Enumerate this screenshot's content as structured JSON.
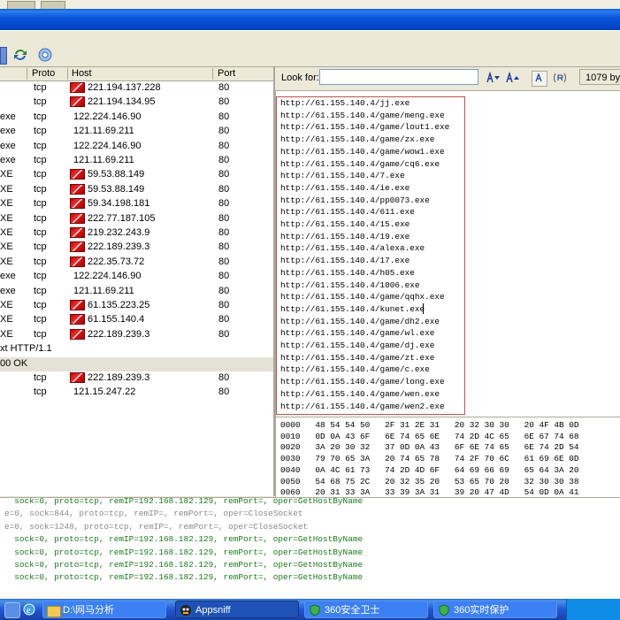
{
  "list": {
    "columns": [
      "Proto",
      "Host",
      "Port"
    ],
    "rows": [
      {
        "proc": "",
        "proto": "tcp",
        "host": "221.194.137.228",
        "port": "80",
        "flag": true
      },
      {
        "proc": "",
        "proto": "tcp",
        "host": "221.194.134.95",
        "port": "80",
        "flag": true
      },
      {
        "proc": "exe",
        "proto": "tcp",
        "host": "122.224.146.90",
        "port": "80",
        "flag": false
      },
      {
        "proc": "exe",
        "proto": "tcp",
        "host": "121.11.69.211",
        "port": "80",
        "flag": false
      },
      {
        "proc": "exe",
        "proto": "tcp",
        "host": "122.224.146.90",
        "port": "80",
        "flag": false
      },
      {
        "proc": "exe",
        "proto": "tcp",
        "host": "121.11.69.211",
        "port": "80",
        "flag": false
      },
      {
        "proc": "XE",
        "proto": "tcp",
        "host": "59.53.88.149",
        "port": "80",
        "flag": true
      },
      {
        "proc": "XE",
        "proto": "tcp",
        "host": "59.53.88.149",
        "port": "80",
        "flag": true
      },
      {
        "proc": "XE",
        "proto": "tcp",
        "host": "59.34.198.181",
        "port": "80",
        "flag": true
      },
      {
        "proc": "XE",
        "proto": "tcp",
        "host": "222.77.187.105",
        "port": "80",
        "flag": true
      },
      {
        "proc": "XE",
        "proto": "tcp",
        "host": "219.232.243.9",
        "port": "80",
        "flag": true
      },
      {
        "proc": "XE",
        "proto": "tcp",
        "host": "222.189.239.3",
        "port": "80",
        "flag": true
      },
      {
        "proc": "XE",
        "proto": "tcp",
        "host": "222.35.73.72",
        "port": "80",
        "flag": true
      },
      {
        "proc": "exe",
        "proto": "tcp",
        "host": "122.224.146.90",
        "port": "80",
        "flag": false
      },
      {
        "proc": "exe",
        "proto": "tcp",
        "host": "121.11.69.211",
        "port": "80",
        "flag": false
      },
      {
        "proc": "XE",
        "proto": "tcp",
        "host": "61.135.223.25",
        "port": "80",
        "flag": true
      },
      {
        "proc": "XE",
        "proto": "tcp",
        "host": "61.155.140.4",
        "port": "80",
        "flag": true
      },
      {
        "proc": "XE",
        "proto": "tcp",
        "host": "222.189.239.3",
        "port": "80",
        "flag": true
      }
    ],
    "band1": "xt HTTP/1.1",
    "band2": "00 OK",
    "rows2": [
      {
        "proc": "",
        "proto": "tcp",
        "host": "222.189.239.3",
        "port": "80",
        "flag": true
      },
      {
        "proc": "",
        "proto": "tcp",
        "host": "121.15.247.22",
        "port": "80",
        "flag": false
      }
    ]
  },
  "search": {
    "label": "Look for:",
    "value": "",
    "size": "1079 byt"
  },
  "urls": [
    "http://61.155.140.4/jj.exe",
    "http://61.155.140.4/game/meng.exe",
    "http://61.155.140.4/game/lout1.exe",
    "http://61.155.140.4/game/zx.exe",
    "http://61.155.140.4/game/wow1.exe",
    "http://61.155.140.4/game/cq6.exe",
    "http://61.155.140.4/7.exe",
    "http://61.155.140.4/ie.exe",
    "http://61.155.140.4/pp0073.exe",
    "http://61.155.140.4/611.exe",
    "http://61.155.140.4/15.exe",
    "http://61.155.140.4/19.exe",
    "http://61.155.140.4/alexa.exe",
    "http://61.155.140.4/17.exe",
    "http://61.155.140.4/h05.exe",
    "http://61.155.140.4/1006.exe",
    "http://61.155.140.4/game/qqhx.exe",
    "http://61.155.140.4/kunet.exe",
    "http://61.155.140.4/game/dh2.exe",
    "http://61.155.140.4/game/wl.exe",
    "http://61.155.140.4/game/dj.exe",
    "http://61.155.140.4/game/zt.exe",
    "http://61.155.140.4/game/c.exe",
    "http://61.155.140.4/game/long.exe",
    "http://61.155.140.4/game/wen.exe",
    "http://61.155.140.4/game/wen2.exe"
  ],
  "hex": [
    "0000   48 54 54 50   2F 31 2E 31   20 32 30 30   20 4F 4B 0D",
    "0010   0D 0A 43 6F   6E 74 65 6E   74 2D 4C 65   6E 67 74 68",
    "0020   3A 20 30 32   37 0D 0A 43   6F 6E 74 65   6E 74 2D 54",
    "0030   79 70 65 3A   20 74 65 78   74 2F 70 6C   61 69 6E 0D",
    "0040   0A 4C 61 73   74 2D 4D 6F   64 69 66 69   65 64 3A 20",
    "0050   54 68 75 2C   20 32 35 20   53 65 70 20   32 30 30 38",
    "0060   20 31 33 3A   33 39 3A 31   39 20 47 4D   54 0D 0A 41"
  ],
  "log": [
    "  sock=0, proto=tcp, remIP=192.168.182.129, remPort=, oper=GetHostByName",
    "e=0, sock=844, proto=tcp, remIP=, remPort=, oper=CloseSocket",
    "e=0, sock=1248, proto=tcp, remIP=, remPort=, oper=CloseSocket",
    "  sock=0, proto=tcp, remIP=192.168.182.129, remPort=, oper=GetHostByName",
    "  sock=0, proto=tcp, remIP=192.168.182.129, remPort=, oper=GetHostByName",
    "  sock=0, proto=tcp, remIP=192.168.182.129, remPort=, oper=GetHostByName",
    "  sock=0, proto=tcp, remIP=192.168.182.129, remPort=, oper=GetHostByName"
  ],
  "taskbar": {
    "items": [
      "D:\\网马分析",
      "Appsniff",
      "360安全卫士",
      "360实时保护"
    ]
  },
  "colors": {
    "log_green": "#1b7a1b",
    "log_gray": "#8a8a8a",
    "url_box": "#c0504d"
  }
}
